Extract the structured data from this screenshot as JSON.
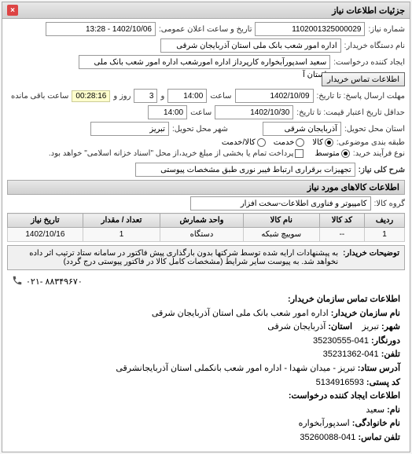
{
  "panel_title": "جزئیات اطلاعات نیاز",
  "fields": {
    "req_number_label": "شماره نیاز:",
    "req_number": "1102001325000029",
    "announce_label": "تاریخ و ساعت اعلان عمومی:",
    "announce_value": "1402/10/06 - 13:28",
    "buyer_org_label": "نام دستگاه خریدار:",
    "buyer_org": "اداره امور شعب بانک ملی استان آذربایجان شرقی",
    "creator_label": "ایجاد کننده درخواست:",
    "creator": "سعید اسدپورآبخواره کارپرداز اداره امورشعب  اداره امور شعب بانک ملی استان آ",
    "contact_btn": "اطلاعات تماس خریدار",
    "deadline_label": "مهلت ارسال پاسخ: تا تاریخ:",
    "deadline_date": "1402/10/09",
    "time_label": "ساعت",
    "deadline_time": "14:00",
    "days_and": "و",
    "days_value": "3",
    "days_unit": "روز و",
    "timer": "00:28:16",
    "timer_suffix": "ساعت باقی مانده",
    "validity_label": "حداقل تاریخ اعتبار قیمت: تا تاریخ:",
    "validity_date": "1402/10/30",
    "validity_time": "14:00",
    "province_label": "استان محل تحویل:",
    "province": "آذربایجان شرقی",
    "city_label": "شهر محل تحویل:",
    "city": "تبریز",
    "packing_label": "طبقه بندی موضوعی:",
    "r_goods": "کالا",
    "r_service": "خدمت",
    "r_both": "کالا/خدمت",
    "purchase_type_label": "نوع فرآیند خرید:",
    "r_low": "متوسط",
    "purchase_note": "پرداخت تمام یا بخشی از مبلغ خرید،از محل \"اسناد خزانه اسلامی\" خواهد بود.",
    "desc_label": "شرح کلی نیاز:",
    "desc_value": "تجهیزات برقراری ارتباط فیبر نوری طبق مشخصات پیوستی",
    "items_title": "اطلاعات کالاهای مورد نیاز",
    "group_label": "گروه کالا:",
    "group_value": "کامپیوتر و فناوری اطلاعات-سخت افزار"
  },
  "table": {
    "headers": [
      "ردیف",
      "کد کالا",
      "نام کالا",
      "واحد شمارش",
      "تعداد / مقدار",
      "تاریخ نیاز"
    ],
    "rows": [
      [
        "1",
        "--",
        "سوییچ شبکه",
        "دستگاه",
        "1",
        "1402/10/16"
      ]
    ]
  },
  "note": {
    "label": "توضیحات خریدار:",
    "text": "به پیشنهادات ارایه شده توسط شرکتها بدون بارگذاری پیش فاکتور در سامانه ستاد ترتیب اثر داده نخواهد شد. به پیوست سایر شرایط (مشخصات کامل کالا در فاکتور پیوستی درج گردد)"
  },
  "contact": {
    "title": "اطلاعات تماس سازمان خریدار:",
    "org_label": "نام سازمان خریدار:",
    "org": "اداره امور شعب بانک ملی استان آذربایجان شرقی",
    "province_label": "استان:",
    "province": "آذربایجان شرقی",
    "city_label": "شهر:",
    "city": "تبریز",
    "fax_label": "دورنگار:",
    "fax": "041-35230555",
    "phone_label": "تلفن:",
    "phone": "041-35231362",
    "address_label": "آدرس ستاد:",
    "address": "تبریز - میدان شهدا - اداره امور شعب بانکملی استان آذربایجانشرقی",
    "postal_label": "کد پستی:",
    "postal": "5134916593",
    "req_creator_title": "اطلاعات ایجاد کننده درخواست:",
    "name_label": "نام:",
    "name": "سعید",
    "lastname_label": "نام خانوادگی:",
    "lastname": "اسدپورآبخواره",
    "contact_phone_label": "تلفن تماس:",
    "contact_phone": "041-35260088"
  },
  "footer_phone": "۸۸۳۴۹۶۷۰ -۰۲۱"
}
